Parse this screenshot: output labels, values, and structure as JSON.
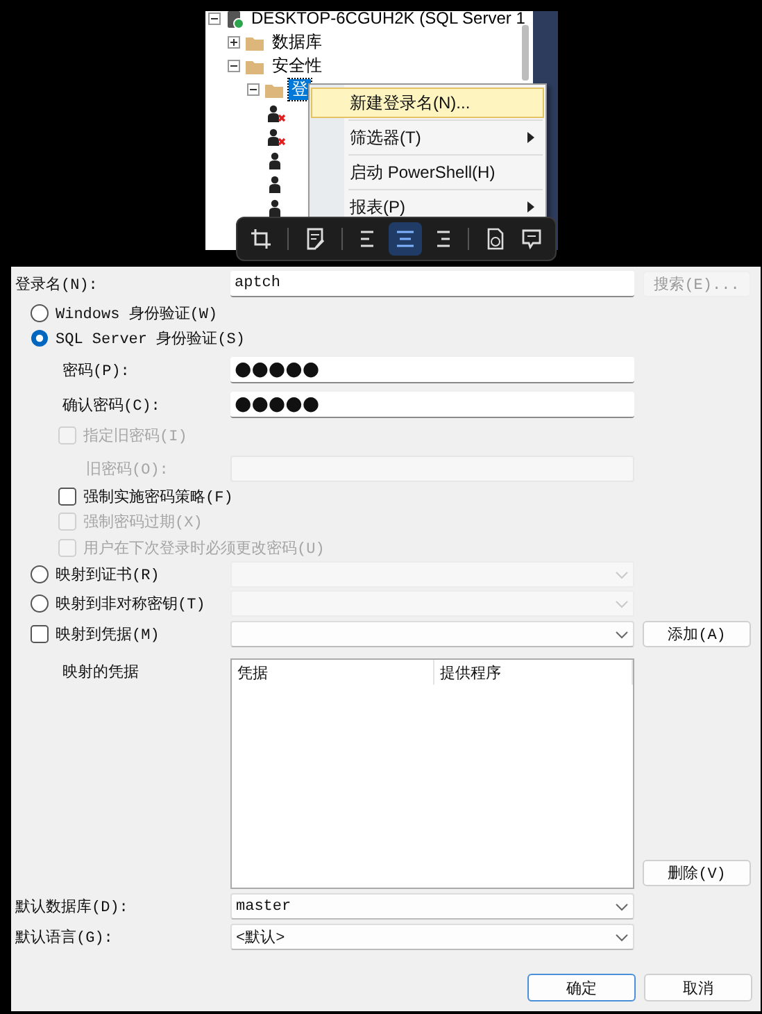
{
  "explorer": {
    "nodes": [
      {
        "label": "DESKTOP-6CGUH2K (SQL Server 1",
        "kind": "server",
        "expanded": true,
        "selected": false,
        "children": [
          {
            "label": "数据库",
            "kind": "folder",
            "expanded": false,
            "selected": false
          },
          {
            "label": "安全性",
            "kind": "folder",
            "expanded": true,
            "selected": false,
            "children": [
              {
                "label": "登",
                "kind": "folder",
                "expanded": true,
                "selected": true,
                "children": [
                  {
                    "kind": "login",
                    "disabled": true,
                    "selected": false
                  },
                  {
                    "kind": "login",
                    "disabled": true,
                    "selected": false
                  },
                  {
                    "kind": "login",
                    "disabled": false,
                    "selected": false
                  },
                  {
                    "kind": "login",
                    "disabled": false,
                    "selected": false
                  },
                  {
                    "kind": "login",
                    "disabled": false,
                    "selected": false
                  }
                ]
              }
            ]
          }
        ]
      }
    ]
  },
  "context_menu": {
    "items": [
      {
        "label": "新建登录名(N)...",
        "highlighted": true,
        "submenu": false
      },
      {
        "label": "筛选器(T)",
        "highlighted": false,
        "submenu": true
      },
      {
        "label": "启动 PowerShell(H)",
        "highlighted": false,
        "submenu": false
      },
      {
        "label": "报表(P)",
        "highlighted": false,
        "submenu": true
      }
    ]
  },
  "toolbar": {
    "groups": [
      [
        {
          "kind": "crop",
          "selected": false
        }
      ],
      [
        {
          "kind": "note",
          "selected": false
        }
      ],
      [
        {
          "kind": "align-left",
          "selected": false
        },
        {
          "kind": "align-center",
          "selected": true
        },
        {
          "kind": "align-right",
          "selected": false
        }
      ],
      [
        {
          "kind": "link",
          "selected": false
        },
        {
          "kind": "comment",
          "selected": false
        }
      ]
    ]
  },
  "dialog": {
    "login_name": {
      "label": "登录名(N):",
      "value": "aptch"
    },
    "search_button": {
      "label": "搜索(E)...",
      "disabled": true
    },
    "auth": [
      {
        "label": "Windows 身份验证(W)",
        "selected": false
      },
      {
        "label": "SQL Server 身份验证(S)",
        "selected": true
      }
    ],
    "passwords": [
      {
        "label": "密码(P):",
        "value": "●●●●●"
      },
      {
        "label": "确认密码(C):",
        "value": "●●●●●"
      }
    ],
    "old_password_check": {
      "label": "指定旧密码(I)",
      "checked": false,
      "disabled": true
    },
    "old_password": {
      "label": "旧密码(O):",
      "disabled": true
    },
    "policies": [
      {
        "label": "强制实施密码策略(F)",
        "checked": false,
        "disabled": false
      },
      {
        "label": "强制密码过期(X)",
        "checked": false,
        "disabled": true
      },
      {
        "label": "用户在下次登录时必须更改密码(U)",
        "checked": false,
        "disabled": true
      }
    ],
    "mappings": [
      {
        "kind": "radio",
        "label": "映射到证书(R)",
        "selected": false,
        "dropdown_disabled": true
      },
      {
        "kind": "radio",
        "label": "映射到非对称密钥(T)",
        "selected": false,
        "dropdown_disabled": true
      },
      {
        "kind": "checkbox",
        "label": "映射到凭据(M)",
        "checked": false,
        "dropdown_disabled": false,
        "button": "添加(A)"
      }
    ],
    "mapped_credentials": {
      "label": "映射的凭据",
      "columns": [
        "凭据",
        "提供程序"
      ],
      "remove_button": "删除(V)"
    },
    "defaults": [
      {
        "label": "默认数据库(D):",
        "value": "master"
      },
      {
        "label": "默认语言(G):",
        "value": "<默认>"
      }
    ],
    "buttons": [
      {
        "label": "确定",
        "default": true
      },
      {
        "label": "取消",
        "default": false
      }
    ]
  }
}
